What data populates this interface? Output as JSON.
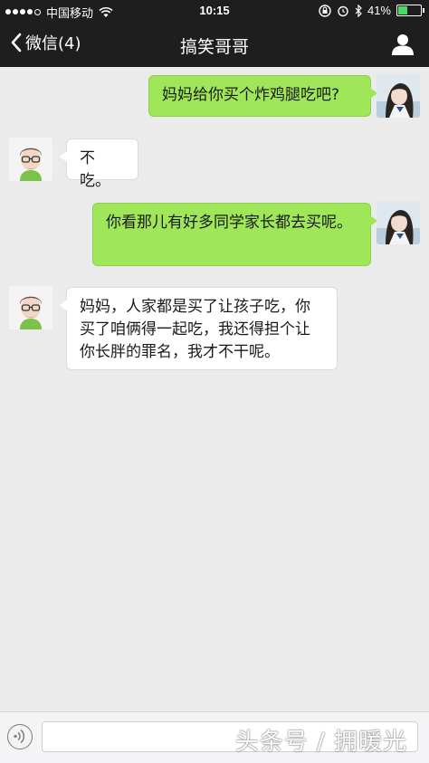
{
  "status_bar": {
    "carrier": "中国移动",
    "time": "10:15",
    "battery": "41%",
    "battery_level": 0.41,
    "signal_dots_filled": 4,
    "signal_dots_total": 5
  },
  "nav": {
    "back_label": "微信(4)",
    "title": "搞笑哥哥",
    "profile_icon": "person-icon"
  },
  "messages": [
    {
      "sender": "me",
      "text": "妈妈给你买个炸鸡腿吃吧?"
    },
    {
      "sender": "them",
      "text": "不吃。"
    },
    {
      "sender": "me",
      "text": "你看那儿有好多同学家长都去买呢。"
    },
    {
      "sender": "them",
      "text": "妈妈，人家都是买了让孩子吃，你买了咱俩得一起吃，我还得担个让你长胖的罪名，我才不干呢。"
    }
  ],
  "input": {
    "voice_icon": "voice-icon",
    "watermark": "头条号 / 拥暖光"
  },
  "colors": {
    "my_bubble": "#9fe658",
    "their_bubble": "#ffffff",
    "bar": "#1e1e1e",
    "chat_bg": "#ebebeb"
  }
}
